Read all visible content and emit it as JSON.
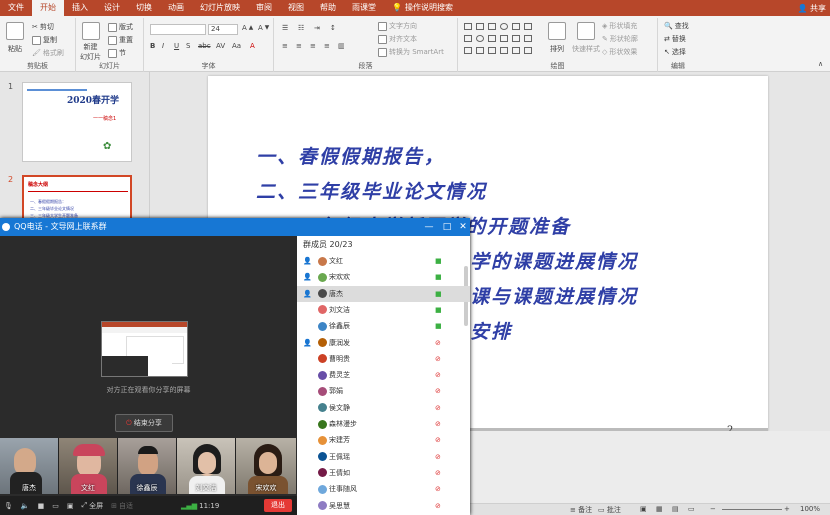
{
  "ribbon": {
    "tabs": [
      {
        "label": "文件"
      },
      {
        "label": "开始"
      },
      {
        "label": "插入"
      },
      {
        "label": "设计"
      },
      {
        "label": "切换"
      },
      {
        "label": "动画"
      },
      {
        "label": "幻灯片放映"
      },
      {
        "label": "审阅"
      },
      {
        "label": "视图"
      },
      {
        "label": "帮助"
      },
      {
        "label": "雨课堂"
      }
    ],
    "tell_me": "操作说明搜索",
    "share": "共享",
    "clipboard": {
      "paste": "粘贴",
      "cut": "剪切",
      "copy": "复制",
      "format_painter": "格式刷",
      "group": "剪贴板"
    },
    "slides": {
      "new_slide": "新建",
      "new_slide2": "幻灯片",
      "layout": "版式",
      "reset": "重置",
      "section": "节",
      "group": "幻灯片"
    },
    "font": {
      "size": "24",
      "group": "字体"
    },
    "paragraph": {
      "text_direction": "文字方向",
      "align_text": "对齐文本",
      "smartart": "转换为 SmartArt",
      "group": "段落"
    },
    "drawing": {
      "arrange": "排列",
      "quick_styles": "快速样式",
      "shape_fill": "形状填充",
      "shape_outline": "形状轮廓",
      "shape_effects": "形状效果",
      "group": "绘图"
    },
    "editing": {
      "find": "查找",
      "replace": "替换",
      "select": "选择",
      "group": "编辑"
    }
  },
  "thumbnails": [
    {
      "number": "1",
      "title": "2020春开学",
      "subtitle": "一一稿念1"
    },
    {
      "number": "2",
      "title": "稿念大纲",
      "lines": [
        "一、春假假期报告：",
        "二、三年级毕业论文情况",
        "三、三年级大学生开题准备"
      ]
    }
  ],
  "slide": {
    "lines": [
      "一、春假假期报告，",
      "二、三年级毕业论文情况",
      "三、二年级大学新同学的开题准备",
      "学的课题进展情况",
      "课与课题进展情况",
      "安排"
    ],
    "prefix3": "三",
    "page_number": "2"
  },
  "status": {
    "notes": "备注",
    "comments": "批注",
    "zoom": "100%"
  },
  "qq": {
    "title": "QQ电话 - 文导网上联系群",
    "share_text": "对方正在观看你分享的屏幕",
    "end_share": "结束分享",
    "collapse": "收起",
    "videos": [
      {
        "name": "唐杰"
      },
      {
        "name": "文红"
      },
      {
        "name": "徐鑫辰"
      },
      {
        "name": "刘文洁"
      },
      {
        "name": "宋欢欢"
      }
    ],
    "controls": {
      "fullscreen": "全屏",
      "fit": "自适",
      "time": "11:19",
      "exit": "退出"
    },
    "members_header": "群成员 20/23",
    "members": [
      {
        "name": "文红",
        "color": "#c8784a",
        "role": "admin",
        "status": "on"
      },
      {
        "name": "宋欢欢",
        "color": "#6aa84f",
        "role": "admin",
        "status": "on"
      },
      {
        "name": "唐杰",
        "color": "#4a4a4a",
        "role": "admin",
        "status": "on"
      },
      {
        "name": "刘文洁",
        "color": "#e06666",
        "role": "",
        "status": "on"
      },
      {
        "name": "徐鑫辰",
        "color": "#3d85c6",
        "role": "",
        "status": "on"
      },
      {
        "name": "康润发",
        "color": "#b45f06",
        "role": "admin",
        "status": "off"
      },
      {
        "name": "曹明贵",
        "color": "#cc4125",
        "role": "",
        "status": "off"
      },
      {
        "name": "费灵芝",
        "color": "#674ea7",
        "role": "",
        "status": "off"
      },
      {
        "name": "郭娟",
        "color": "#a64d79",
        "role": "",
        "status": "off"
      },
      {
        "name": "侯文静",
        "color": "#45818e",
        "role": "",
        "status": "off"
      },
      {
        "name": "森林漫步",
        "color": "#38761d",
        "role": "",
        "status": "off"
      },
      {
        "name": "宋建芳",
        "color": "#e69138",
        "role": "",
        "status": "off"
      },
      {
        "name": "王佩瑶",
        "color": "#0b5394",
        "role": "",
        "status": "off"
      },
      {
        "name": "王倩如",
        "color": "#741b47",
        "role": "",
        "status": "off"
      },
      {
        "name": "往事随风",
        "color": "#6fa8dc",
        "role": "",
        "status": "off"
      },
      {
        "name": "吴思慧",
        "color": "#8e7cc3",
        "role": "",
        "status": "off"
      }
    ]
  }
}
